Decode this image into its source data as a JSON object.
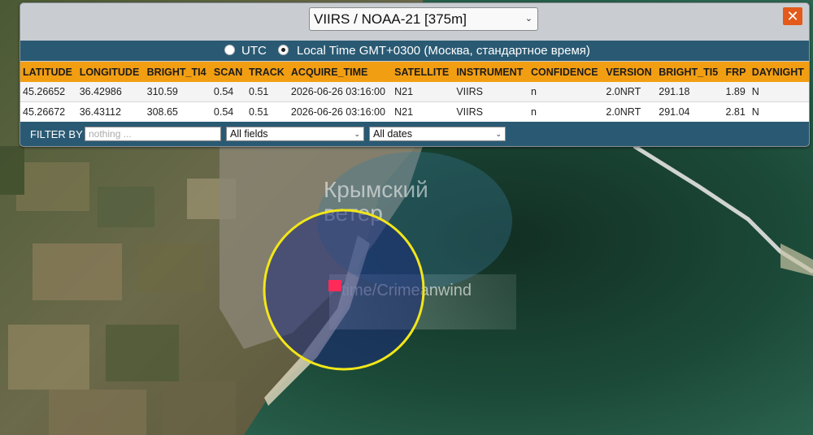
{
  "satellite_select": {
    "value": "VIIRS / NOAA-21 [375m]",
    "chevron_icon": "chevron-down-icon"
  },
  "close_button": {
    "label": "✕",
    "color": "#e35a1a"
  },
  "timezone": {
    "utc_label": "UTC",
    "local_label": "Local Time GMT+0300 (Москва, стандартное время)",
    "selected": "local"
  },
  "table": {
    "columns": [
      "LATITUDE",
      "LONGITUDE",
      "BRIGHT_TI4",
      "SCAN",
      "TRACK",
      "ACQUIRE_TIME",
      "SATELLITE",
      "INSTRUMENT",
      "CONFIDENCE",
      "VERSION",
      "BRIGHT_TI5",
      "FRP",
      "DAYNIGHT"
    ],
    "rows": [
      [
        "45.26652",
        "36.42986",
        "310.59",
        "0.54",
        "0.51",
        "2026-06-26 03:16:00",
        "N21",
        "VIIRS",
        "n",
        "2.0NRT",
        "291.18",
        "1.89",
        "N"
      ],
      [
        "45.26672",
        "36.43112",
        "308.65",
        "0.54",
        "0.51",
        "2026-06-26 03:16:00",
        "N21",
        "VIIRS",
        "n",
        "2.0NRT",
        "291.04",
        "2.81",
        "N"
      ]
    ],
    "header_color": "#f29e12"
  },
  "filter": {
    "label": "FILTER BY",
    "input_placeholder": "nothing ...",
    "field_select": "All fields",
    "date_select": "All dates"
  },
  "watermark": {
    "line1": "Крымский",
    "line2": "ветер",
    "caption": "time/Crimeanwind"
  },
  "map": {
    "highlight_circle_color": "#f2e619",
    "fire_marker_color": "#ff2a5a"
  }
}
